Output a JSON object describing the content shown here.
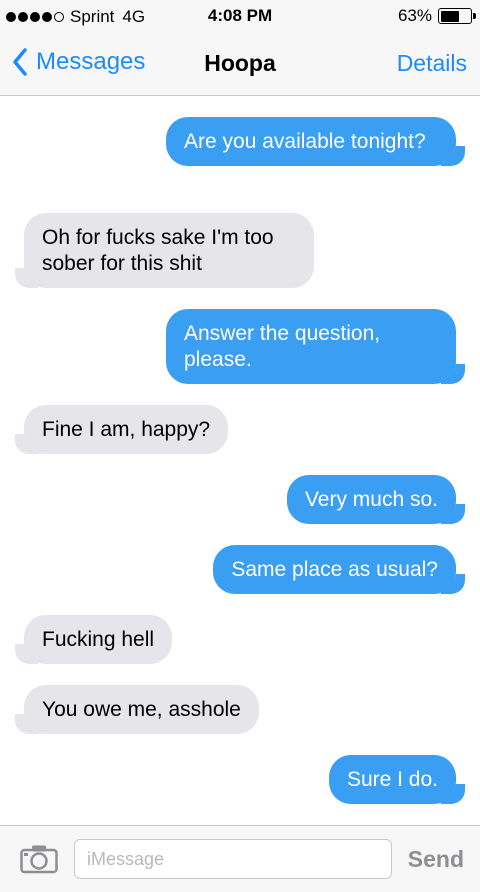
{
  "status_bar": {
    "signal_bars_filled": 4,
    "signal_bars_total": 5,
    "carrier": "Sprint",
    "network": "4G",
    "time": "4:08 PM",
    "battery_percent": "63%",
    "battery_level": 0.63
  },
  "nav": {
    "back_label": "Messages",
    "title": "Hoopa",
    "details_label": "Details"
  },
  "messages": [
    {
      "direction": "outgoing",
      "text": "Are you available tonight?"
    },
    {
      "direction": "incoming",
      "text": "Oh for fucks sake I'm too sober for this shit"
    },
    {
      "direction": "outgoing",
      "text": "Answer the question, please."
    },
    {
      "direction": "incoming",
      "text": "Fine I am, happy?"
    },
    {
      "direction": "outgoing",
      "text": "Very much so."
    },
    {
      "direction": "outgoing",
      "text": "Same place as usual?"
    },
    {
      "direction": "incoming",
      "text": "Fucking hell"
    },
    {
      "direction": "incoming",
      "text": "You owe me, asshole"
    },
    {
      "direction": "outgoing",
      "text": "Sure I do."
    }
  ],
  "composer": {
    "camera_icon": "camera-icon",
    "placeholder": "iMessage",
    "value": "",
    "send_label": "Send"
  },
  "colors": {
    "accent": "#1a8cff",
    "outgoing_bubble": "#3a9ef2",
    "incoming_bubble": "#e5e5ea",
    "send_disabled": "#8e8e93"
  }
}
